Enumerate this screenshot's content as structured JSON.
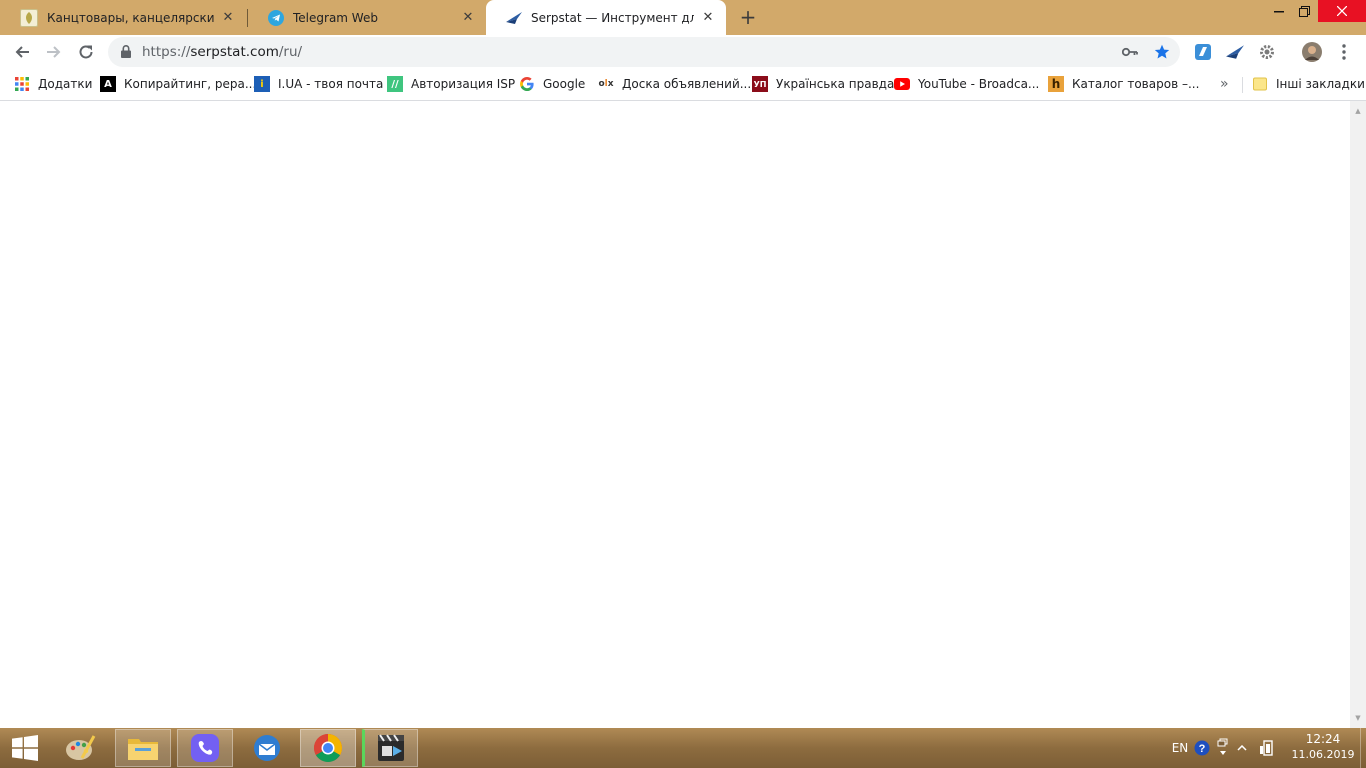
{
  "tabs": [
    {
      "title": "Канцтовары, канцелярские товары",
      "favicon": "kanc-leaf-icon",
      "active": false
    },
    {
      "title": "Telegram Web",
      "favicon": "telegram-icon",
      "active": false
    },
    {
      "title": "Serpstat — Инструмент для взрывного роста",
      "favicon": "serpstat-icon",
      "active": true
    }
  ],
  "toolbar": {
    "url_scheme": "https://",
    "url_host": "serpstat.com",
    "url_path": "/ru/"
  },
  "bookmarks": [
    {
      "label": "Додатки",
      "icon": "apps-grid-icon"
    },
    {
      "label": "Копирайтинг, рера...",
      "icon": "advego-icon"
    },
    {
      "label": "I.UA - твоя почта",
      "icon": "iua-icon"
    },
    {
      "label": "Авторизация ISP",
      "icon": "isp-icon"
    },
    {
      "label": "Google",
      "icon": "google-icon"
    },
    {
      "label": "Доска объявлений...",
      "icon": "olx-icon"
    },
    {
      "label": "Українська правда",
      "icon": "up-icon"
    },
    {
      "label": "YouTube - Broadca...",
      "icon": "youtube-icon"
    },
    {
      "label": "Каталог товаров –...",
      "icon": "hotline-icon"
    }
  ],
  "bookmarks_more": "»",
  "other_bookmarks": "Інші закладки",
  "taskbar": {
    "language": "EN",
    "time": "12:24",
    "date": "11.06.2019"
  },
  "colors": {
    "frame": "#d2a96a",
    "star": "#1a73e8",
    "close_hover": "#e81123"
  }
}
